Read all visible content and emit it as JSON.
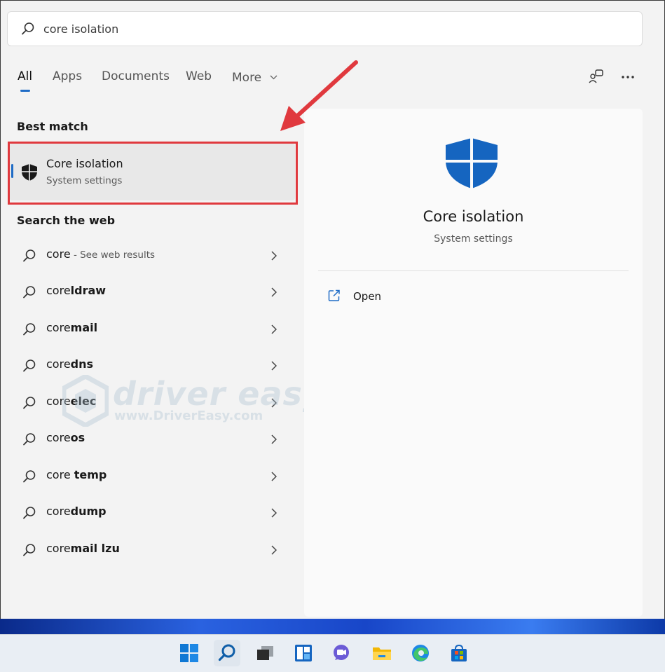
{
  "search": {
    "query": "core isolation"
  },
  "tabs": [
    {
      "label": "All"
    },
    {
      "label": "Apps"
    },
    {
      "label": "Documents"
    },
    {
      "label": "Web"
    },
    {
      "label": "More"
    }
  ],
  "sections": {
    "best_match": "Best match",
    "search_web": "Search the web"
  },
  "best_match": {
    "title": "Core isolation",
    "subtitle": "System settings"
  },
  "web_results": [
    {
      "prefix": "core",
      "suffix": "",
      "hint": " - See web results"
    },
    {
      "prefix": "core",
      "suffix": "ldraw",
      "hint": ""
    },
    {
      "prefix": "core",
      "suffix": "mail",
      "hint": ""
    },
    {
      "prefix": "core",
      "suffix": "dns",
      "hint": ""
    },
    {
      "prefix": "core",
      "suffix": "elec",
      "hint": ""
    },
    {
      "prefix": "core",
      "suffix": "os",
      "hint": ""
    },
    {
      "prefix": "core ",
      "suffix": "temp",
      "hint": ""
    },
    {
      "prefix": "core",
      "suffix": "dump",
      "hint": ""
    },
    {
      "prefix": "core",
      "suffix": "mail lzu",
      "hint": ""
    }
  ],
  "detail": {
    "title": "Core isolation",
    "subtitle": "System settings",
    "open_label": "Open"
  },
  "watermark": {
    "brand": "driver easy",
    "url": "www.DriverEasy.com"
  },
  "colors": {
    "accent": "#1f6cc6",
    "highlight_box": "#e0393e",
    "shield": "#1565c0"
  },
  "icons": {
    "search": "search-icon",
    "chevron": "chevron-right-icon",
    "shield": "shield-icon",
    "open": "open-external-icon",
    "more": "more-options-icon",
    "feedback": "feedback-icon"
  }
}
